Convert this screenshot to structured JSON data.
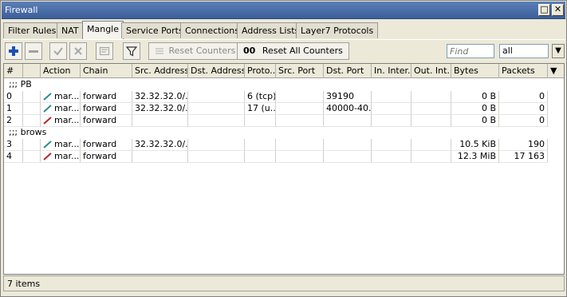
{
  "window": {
    "title": "Firewall",
    "restore_glyph": "□",
    "close_glyph": "✕"
  },
  "tabs": [
    "Filter Rules",
    "NAT",
    "Mangle",
    "Service Ports",
    "Connections",
    "Address Lists",
    "Layer7 Protocols"
  ],
  "active_tab": "Mangle",
  "toolbar": {
    "add_icon": "plus-icon",
    "remove_icon": "minus-icon",
    "enable_icon": "check-icon",
    "disable_icon": "cross-icon",
    "comment_icon": "note-icon",
    "filter_icon": "funnel-icon",
    "reset_counters_label": "Reset Counters",
    "reset_all_counters_label": "Reset All Counters",
    "reset_all_icon_text": "00",
    "find_placeholder": "Find",
    "filter_value": "all",
    "filter_arrow": "▼"
  },
  "columns": [
    "#",
    "",
    "Action",
    "Chain",
    "Src. Address",
    "Dst. Address",
    "Proto...",
    "Src. Port",
    "Dst. Port",
    "In. Inter...",
    "Out. Int...",
    "Bytes",
    "Packets"
  ],
  "rows": [
    {
      "type": "comment",
      "text": ";;; PB"
    },
    {
      "type": "rule",
      "num": "0",
      "icon": "teal",
      "action": "mar...",
      "chain": "forward",
      "src": "32.32.32.0/...",
      "dst": "",
      "proto": "6 (tcp)",
      "sport": "",
      "dport": "39190",
      "in": "",
      "out": "",
      "bytes": "0 B",
      "packets": "0"
    },
    {
      "type": "rule",
      "num": "1",
      "icon": "teal",
      "action": "mar...",
      "chain": "forward",
      "src": "32.32.32.0/...",
      "dst": "",
      "proto": "17 (u...",
      "sport": "",
      "dport": "40000-40...",
      "in": "",
      "out": "",
      "bytes": "0 B",
      "packets": "0"
    },
    {
      "type": "rule",
      "num": "2",
      "icon": "red",
      "action": "mar...",
      "chain": "forward",
      "src": "",
      "dst": "",
      "proto": "",
      "sport": "",
      "dport": "",
      "in": "",
      "out": "",
      "bytes": "0 B",
      "packets": "0"
    },
    {
      "type": "comment",
      "text": ";;; brows"
    },
    {
      "type": "rule",
      "num": "3",
      "icon": "teal",
      "action": "mar...",
      "chain": "forward",
      "src": "32.32.32.0/...",
      "dst": "",
      "proto": "",
      "sport": "",
      "dport": "",
      "in": "",
      "out": "",
      "bytes": "10.5 KiB",
      "packets": "190"
    },
    {
      "type": "rule",
      "num": "4",
      "icon": "red",
      "action": "mar...",
      "chain": "forward",
      "src": "",
      "dst": "",
      "proto": "",
      "sport": "",
      "dport": "",
      "in": "",
      "out": "",
      "bytes": "12.3 MiB",
      "packets": "17 163"
    }
  ],
  "status": "7 items",
  "colors": {
    "teal_pen": "#2a8c8c",
    "red_pen": "#c02020",
    "add_blue": "#1c4fb5"
  }
}
